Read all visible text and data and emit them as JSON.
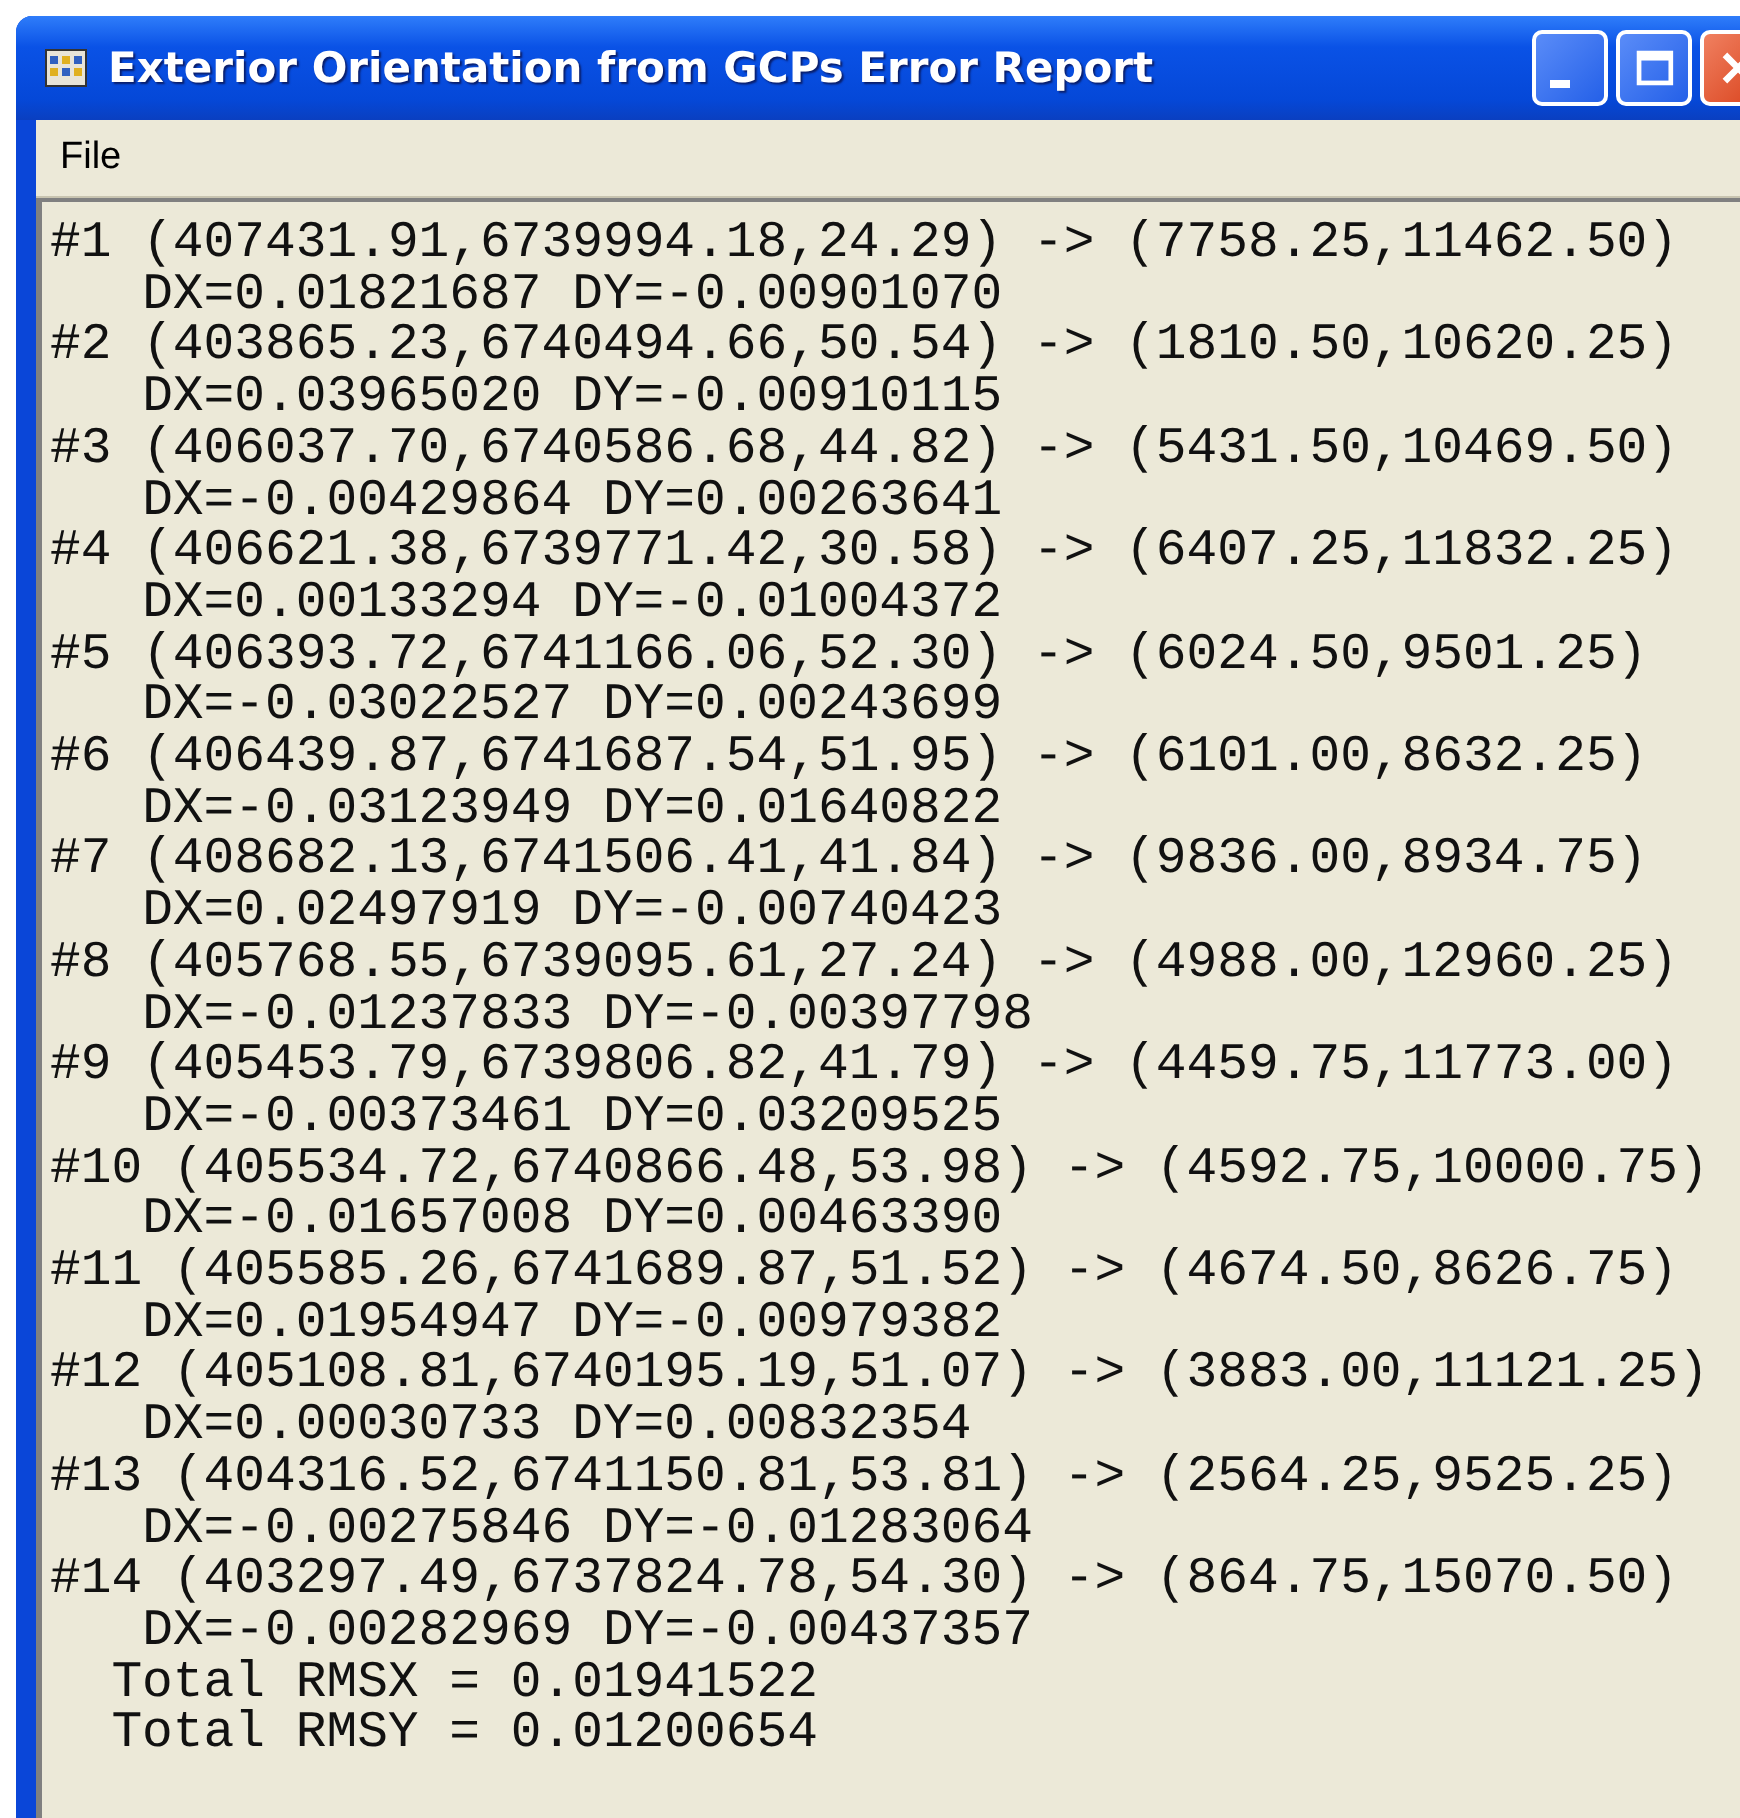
{
  "window": {
    "title": "Exterior Orientation from GCPs Error Report"
  },
  "menu": [
    "File"
  ],
  "report": {
    "points": [
      {
        "line": "#1 (407431.91,6739994.18,24.29) -> (7758.25,11462.50)",
        "detail": "DX=0.01821687 DY=-0.00901070"
      },
      {
        "line": "#2 (403865.23,6740494.66,50.54) -> (1810.50,10620.25)",
        "detail": "DX=0.03965020 DY=-0.00910115"
      },
      {
        "line": "#3 (406037.70,6740586.68,44.82) -> (5431.50,10469.50)",
        "detail": "DX=-0.00429864 DY=0.00263641"
      },
      {
        "line": "#4 (406621.38,6739771.42,30.58) -> (6407.25,11832.25)",
        "detail": "DX=0.00133294 DY=-0.01004372"
      },
      {
        "line": "#5 (406393.72,6741166.06,52.30) -> (6024.50,9501.25)",
        "detail": "DX=-0.03022527 DY=0.00243699"
      },
      {
        "line": "#6 (406439.87,6741687.54,51.95) -> (6101.00,8632.25)",
        "detail": "DX=-0.03123949 DY=0.01640822"
      },
      {
        "line": "#7 (408682.13,6741506.41,41.84) -> (9836.00,8934.75)",
        "detail": "DX=0.02497919 DY=-0.00740423"
      },
      {
        "line": "#8 (405768.55,6739095.61,27.24) -> (4988.00,12960.25)",
        "detail": "DX=-0.01237833 DY=-0.00397798"
      },
      {
        "line": "#9 (405453.79,6739806.82,41.79) -> (4459.75,11773.00)",
        "detail": "DX=-0.00373461 DY=0.03209525"
      },
      {
        "line": "#10 (405534.72,6740866.48,53.98) -> (4592.75,10000.75)",
        "detail": "DX=-0.01657008 DY=0.00463390"
      },
      {
        "line": "#11 (405585.26,6741689.87,51.52) -> (4674.50,8626.75)",
        "detail": "DX=0.01954947 DY=-0.00979382"
      },
      {
        "line": "#12 (405108.81,6740195.19,51.07) -> (3883.00,11121.25)",
        "detail": "DX=0.00030733 DY=0.00832354"
      },
      {
        "line": "#13 (404316.52,6741150.81,53.81) -> (2564.25,9525.25)",
        "detail": "DX=-0.00275846 DY=-0.01283064"
      },
      {
        "line": "#14 (403297.49,6737824.78,54.30) -> (864.75,15070.50)",
        "detail": "DX=-0.00282969 DY=-0.00437357"
      }
    ],
    "totals": [
      "Total RMSX = 0.01941522",
      "Total RMSY = 0.01200654"
    ]
  }
}
